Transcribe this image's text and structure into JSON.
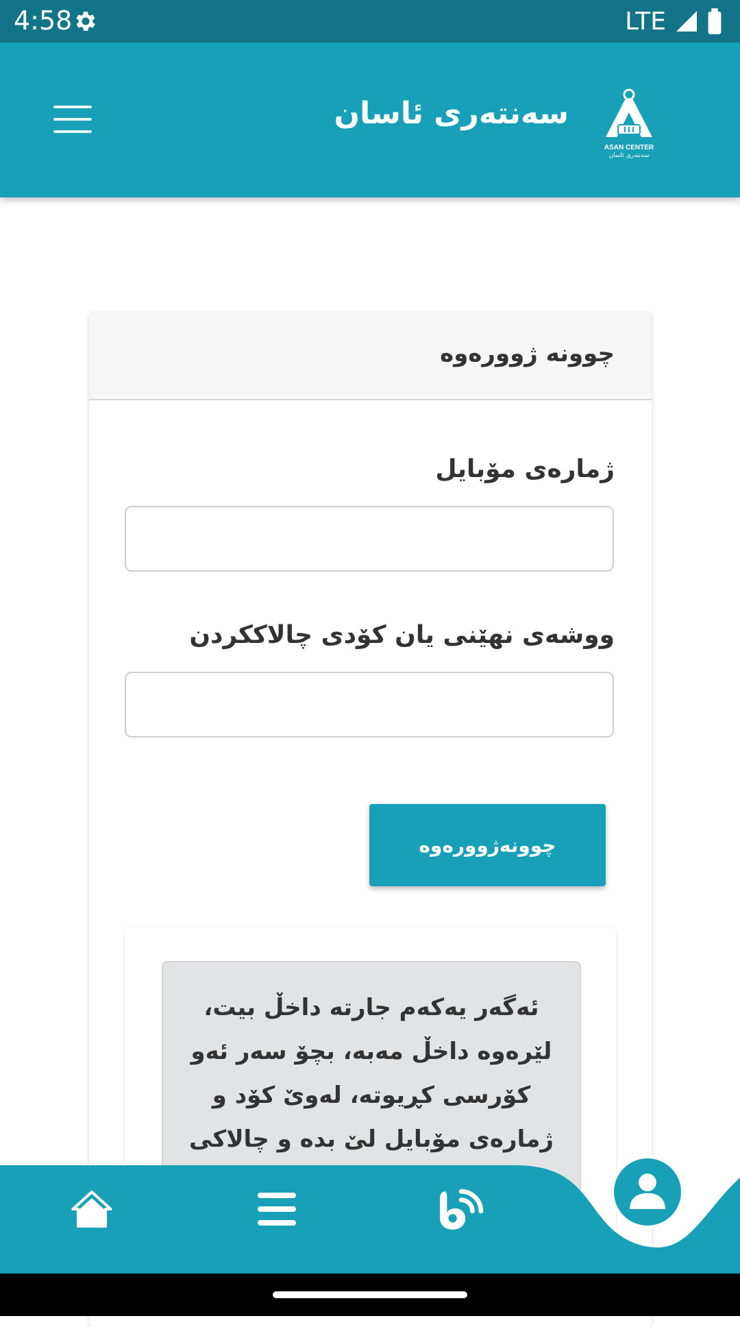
{
  "status_bar": {
    "time": "4:58",
    "network": "LTE",
    "icons": [
      "gear-icon",
      "signal-icon",
      "battery-icon"
    ]
  },
  "app_bar": {
    "title": "سەنتەری ئاسان",
    "logo_text": "ASAN CENTER",
    "logo_subtext": "سەنتەری ئاسان",
    "menu_icon": "hamburger-icon"
  },
  "login_card": {
    "header_title": "چوونە ژوورەوە",
    "mobile_label": "ژمارەی مۆبایل",
    "mobile_value": "",
    "password_label": "ووشەی نهێنی یان کۆدی چالاککردن",
    "password_value": "",
    "submit_label": "چوونەژوورەوە",
    "notice_text": "ئەگەر یەکەم جارتە داخڵ بیت، لێرەوە داخڵ مەبە، بچۆ سەر ئەو کۆرسی کڕیوتە، لەوێ کۆد و ژمارەی مۆبایل لێ بدە و چالاکی"
  },
  "bottom_nav": {
    "items": [
      "home-icon",
      "menu-icon",
      "contact-icon",
      "profile-icon"
    ]
  },
  "colors": {
    "primary": "#18a0b9",
    "status_bar": "#137487",
    "notice_bg": "#e2e3e5"
  }
}
